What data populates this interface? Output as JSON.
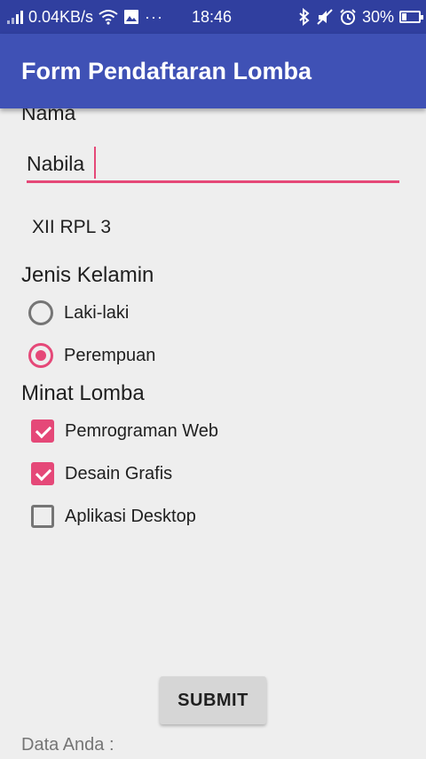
{
  "status_bar": {
    "speed": "0.04KB/s",
    "time": "18:46",
    "battery": "30%",
    "battery_level": 0.3,
    "icons": [
      "signal-icon",
      "wifi-icon",
      "image-icon",
      "more-icon",
      "bluetooth-icon",
      "mute-icon",
      "alarm-icon",
      "battery-icon"
    ]
  },
  "app_bar": {
    "title": "Form Pendaftaran Lomba"
  },
  "form": {
    "name_label": "Nama",
    "name_value": "Nabila",
    "class_value": "XII RPL 3",
    "gender_label": "Jenis Kelamin",
    "gender_options": [
      {
        "label": "Laki-laki",
        "selected": false
      },
      {
        "label": "Perempuan",
        "selected": true
      }
    ],
    "minat_label": "Minat Lomba",
    "minat_options": [
      {
        "label": "Pemrograman Web",
        "checked": true
      },
      {
        "label": "Desain Grafis",
        "checked": true
      },
      {
        "label": "Aplikasi Desktop",
        "checked": false
      }
    ],
    "submit_label": "SUBMIT",
    "result_label": "Data Anda :"
  },
  "colors": {
    "status_bar": "#303f9f",
    "app_bar": "#3f51b5",
    "accent": "#e54878",
    "background": "#eeeeee"
  }
}
